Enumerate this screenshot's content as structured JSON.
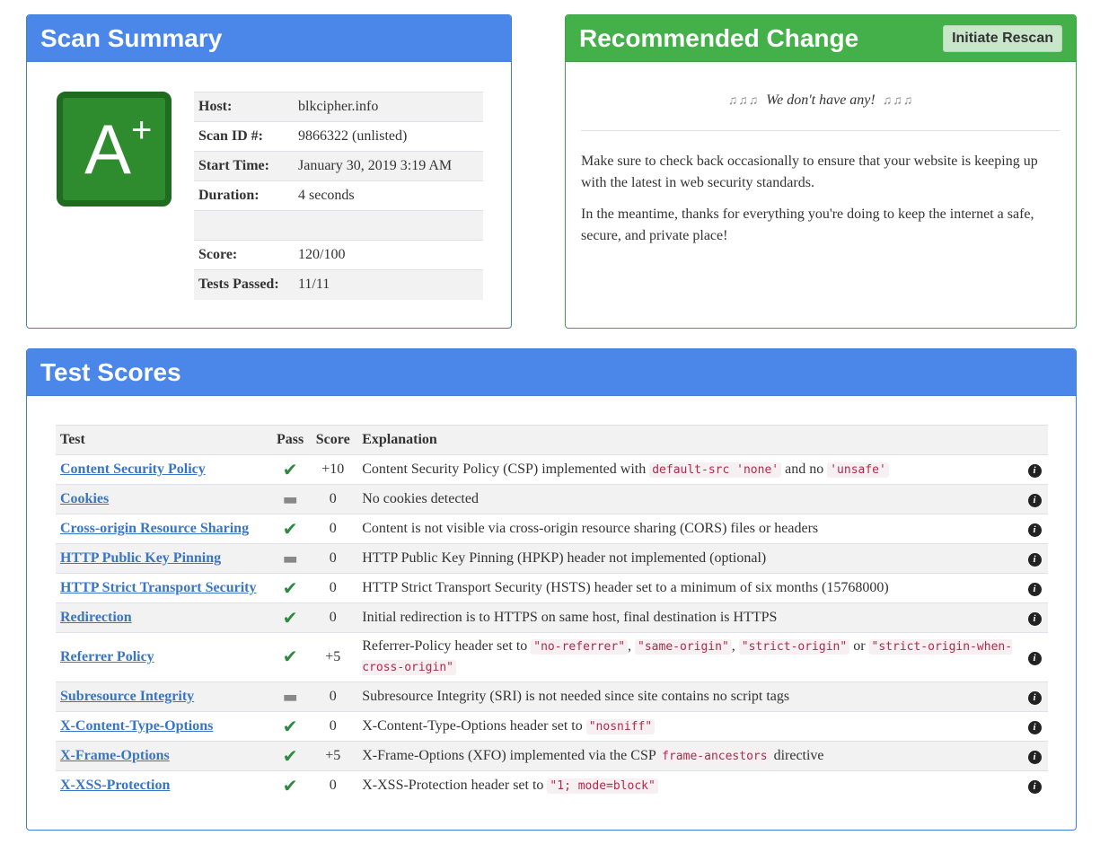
{
  "scan_summary": {
    "title": "Scan Summary",
    "grade_letter": "A",
    "grade_modifier": "+",
    "rows": [
      {
        "key": "Host:",
        "value": "blkcipher.info"
      },
      {
        "key": "Scan ID #:",
        "value": "9866322 (unlisted)"
      },
      {
        "key": "Start Time:",
        "value": "January 30, 2019 3:19 AM"
      },
      {
        "key": "Duration:",
        "value": "4 seconds"
      },
      {
        "key": "",
        "value": ""
      },
      {
        "key": "Score:",
        "value": "120/100"
      },
      {
        "key": "Tests Passed:",
        "value": "11/11"
      }
    ]
  },
  "recommended": {
    "title": "Recommended Change",
    "rescan_label": "Initiate Rescan",
    "none_text": "We don't have any!",
    "para1": "Make sure to check back occasionally to ensure that your website is keeping up with the latest in web security standards.",
    "para2": "In the meantime, thanks for everything you're doing to keep the internet a safe, secure, and private place!"
  },
  "test_scores": {
    "title": "Test Scores",
    "headers": {
      "test": "Test",
      "pass": "Pass",
      "score": "Score",
      "explanation": "Explanation"
    },
    "rows": [
      {
        "test": "Content Security Policy",
        "pass": "check",
        "score": "+10",
        "parts": [
          {
            "t": "Content Security Policy (CSP) implemented with "
          },
          {
            "c": "default-src 'none'"
          },
          {
            "t": " and no "
          },
          {
            "c": "'unsafe'"
          }
        ]
      },
      {
        "test": "Cookies",
        "pass": "dash",
        "score": "0",
        "parts": [
          {
            "t": "No cookies detected"
          }
        ]
      },
      {
        "test": "Cross-origin Resource Sharing",
        "pass": "check",
        "score": "0",
        "parts": [
          {
            "t": "Content is not visible via cross-origin resource sharing (CORS) files or headers"
          }
        ]
      },
      {
        "test": "HTTP Public Key Pinning",
        "pass": "dash",
        "score": "0",
        "parts": [
          {
            "t": "HTTP Public Key Pinning (HPKP) header not implemented (optional)"
          }
        ]
      },
      {
        "test": "HTTP Strict Transport Security",
        "pass": "check",
        "score": "0",
        "parts": [
          {
            "t": "HTTP Strict Transport Security (HSTS) header set to a minimum of six months (15768000)"
          }
        ]
      },
      {
        "test": "Redirection",
        "pass": "check",
        "score": "0",
        "parts": [
          {
            "t": "Initial redirection is to HTTPS on same host, final destination is HTTPS"
          }
        ]
      },
      {
        "test": "Referrer Policy",
        "pass": "check",
        "score": "+5",
        "parts": [
          {
            "t": "Referrer-Policy header set to "
          },
          {
            "c": "\"no-referrer\""
          },
          {
            "t": ", "
          },
          {
            "c": "\"same-origin\""
          },
          {
            "t": ", "
          },
          {
            "c": "\"strict-origin\""
          },
          {
            "t": " or "
          },
          {
            "c": "\"strict-origin-when-cross-origin\""
          }
        ]
      },
      {
        "test": "Subresource Integrity",
        "pass": "dash",
        "score": "0",
        "parts": [
          {
            "t": "Subresource Integrity (SRI) is not needed since site contains no script tags"
          }
        ]
      },
      {
        "test": "X-Content-Type-Options",
        "pass": "check",
        "score": "0",
        "parts": [
          {
            "t": "X-Content-Type-Options header set to "
          },
          {
            "c": "\"nosniff\""
          }
        ]
      },
      {
        "test": "X-Frame-Options",
        "pass": "check",
        "score": "+5",
        "parts": [
          {
            "t": "X-Frame-Options (XFO) implemented via the CSP "
          },
          {
            "c": "frame-ancestors"
          },
          {
            "t": " directive"
          }
        ]
      },
      {
        "test": "X-XSS-Protection",
        "pass": "check",
        "score": "0",
        "parts": [
          {
            "t": "X-XSS-Protection header set to "
          },
          {
            "c": "\"1; mode=block\""
          }
        ]
      }
    ]
  },
  "colors": {
    "blue_header": "#4a87e8",
    "green_header": "#43b049",
    "grade_green": "#2e8b2e",
    "link": "#3a75c4",
    "pass_check": "#2b8a3e"
  }
}
